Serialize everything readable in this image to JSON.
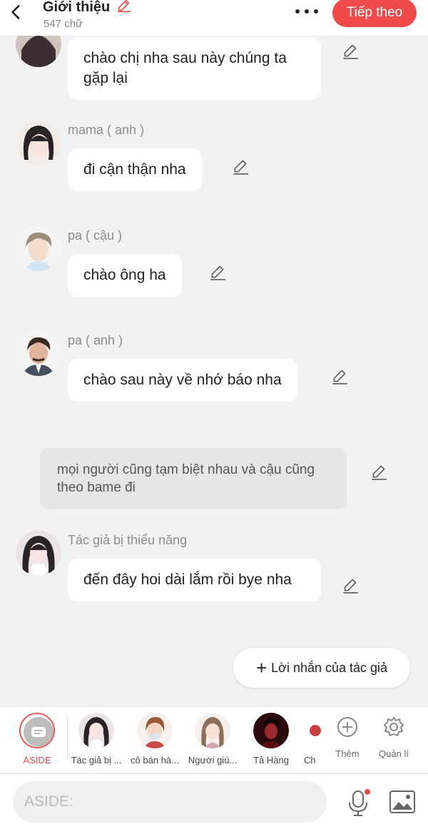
{
  "header": {
    "title": "Giới thiệu",
    "word_count": "547 chữ",
    "next_button": "Tiếp theo",
    "icons": {
      "back": "chevron-left-icon",
      "edit": "pencil-icon",
      "more": "more-horizontal-icon"
    }
  },
  "messages": [
    {
      "speaker": "",
      "text": "chào chị nha sau này chúng ta gặp lại"
    },
    {
      "speaker": "mama ( anh )",
      "text": "đi cận thận nha"
    },
    {
      "speaker": "pa ( cậu )",
      "text": "chào ông ha"
    },
    {
      "speaker": "pa ( anh )",
      "text": "chào sau này về nhớ báo nha"
    },
    {
      "narration": "mọi người cũng tạm biệt nhau và cậu cũng theo bame đi"
    },
    {
      "speaker": "Tác giả bị thiểu năng",
      "text": "đến đây hoi dài lắm rồi bye nha"
    }
  ],
  "author_note_button": "Lời nhắn của tác giả",
  "character_bar": {
    "aside_label": "ASIDE",
    "characters": [
      "Tác giả bị ...",
      "cô bán hà...",
      "Người giú...",
      "Tả Hàng",
      "Ch"
    ],
    "more_label": "Thêm",
    "manage_label": "Quản lí"
  },
  "input": {
    "placeholder": "ASIDE:"
  },
  "colors": {
    "accent": "#f04a4a",
    "background": "#f2f2f2",
    "bubble": "#ffffff",
    "narration": "#e6e6e6"
  }
}
